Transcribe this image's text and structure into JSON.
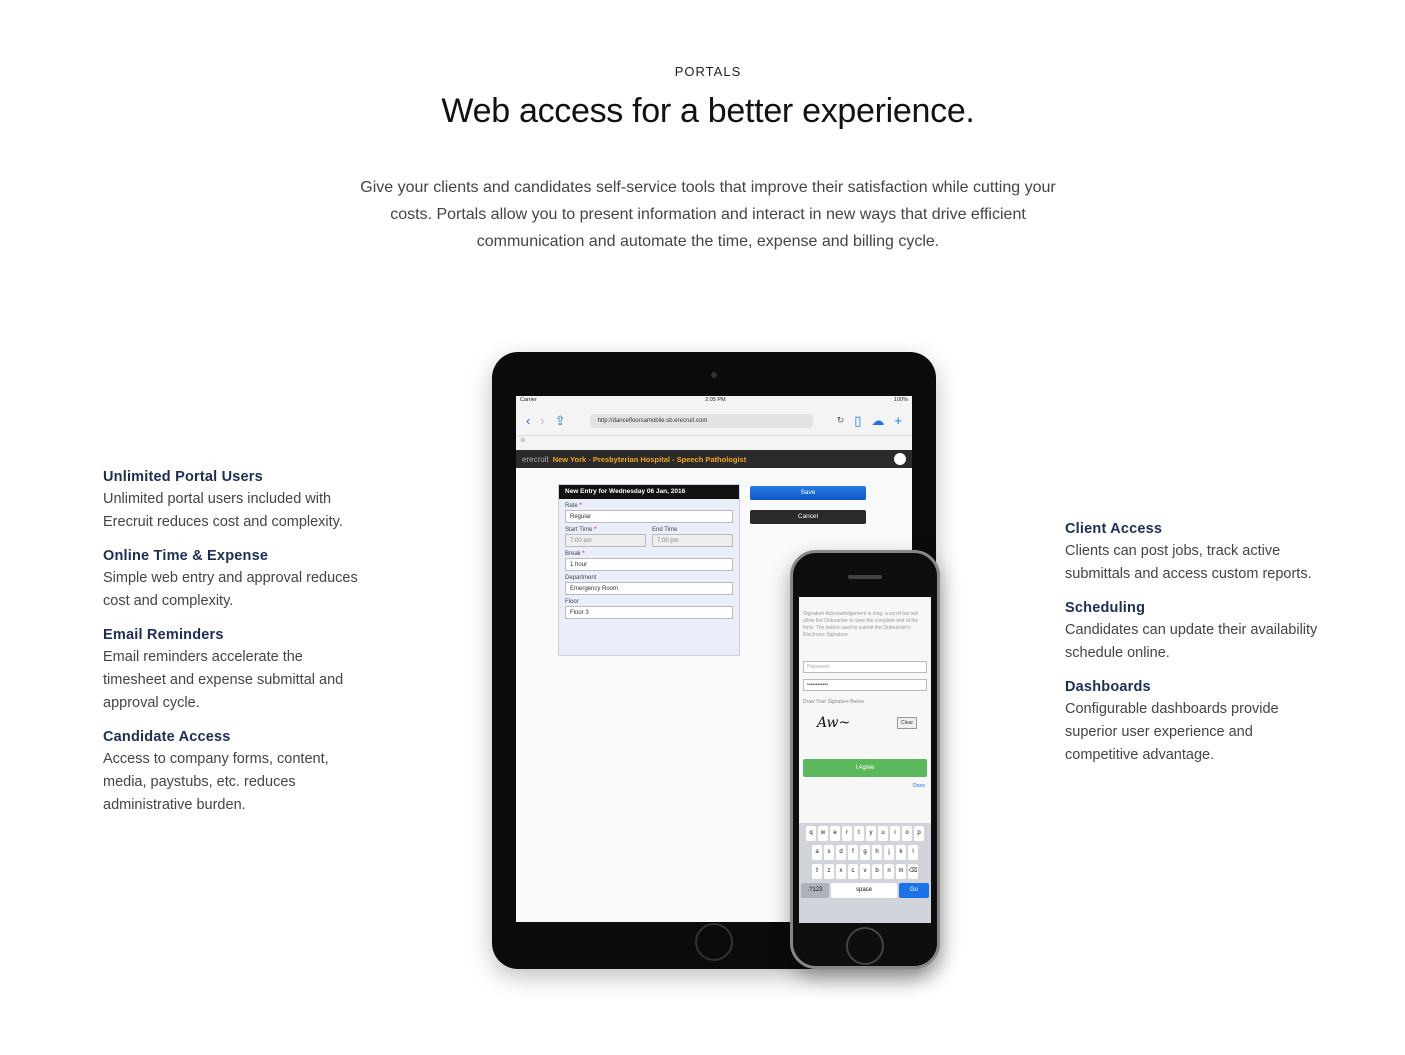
{
  "section": {
    "eyebrow": "PORTALS",
    "headline": "Web access for a better experience.",
    "intro": "Give your clients and candidates self-service tools that improve their satisfaction while cutting your costs. Portals allow you to present information and interact in new ways that drive efficient communication and automate the time, expense and billing cycle."
  },
  "features_left": [
    {
      "title": "Unlimited Portal Users",
      "desc": "Unlimited portal users included with Erecruit reduces cost and complexity."
    },
    {
      "title": "Online Time & Expense",
      "desc": "Simple web entry and approval reduces cost and complexity."
    },
    {
      "title": "Email Reminders",
      "desc": "Email reminders accelerate the timesheet and expense submittal and approval cycle."
    },
    {
      "title": "Candidate Access",
      "desc": "Access to company forms, content, media, paystubs, etc. reduces administrative burden."
    }
  ],
  "features_right": [
    {
      "title": "Client Access",
      "desc": "Clients can post jobs, track active submittals and access custom reports."
    },
    {
      "title": "Scheduling",
      "desc": "Candidates can update their availability schedule online."
    },
    {
      "title": "Dashboards",
      "desc": "Configurable dashboards provide superior user experience and competitive advantage."
    }
  ],
  "tablet": {
    "status_left": "Carrier",
    "status_time": "2:05 PM",
    "status_right": "100%",
    "url": "http://dancefloorsamobile.sb.erecruit.com",
    "app_brand": "erecruit",
    "app_title": "New York - Presbyterian Hospital - Speech Pathologist",
    "form_header": "New Entry for Wednesday 06 Jan, 2016",
    "rate_label": "Rate",
    "rate_value": "Regular",
    "start_label": "Start Time",
    "start_value": "7:00 am",
    "end_label": "End Time",
    "end_value": "7:00 pm",
    "break_label": "Break",
    "break_value": "1 hour",
    "department_label": "Department",
    "department_value": "Emergency Room",
    "floor_label": "Floor",
    "floor_value": "Floor 3",
    "save_label": "Save",
    "cancel_label": "Cancel",
    "required_mark": "*"
  },
  "phone": {
    "body_text": "Signature Acknowledgement is long, a scroll bar will allow the Onboarder to view the complete text of the form. The button used to submit the Onboarder's Electronic Signature",
    "password_placeholder": "Password",
    "password_value": "••••••••••••",
    "signature_label": "Draw Your Signature Below",
    "clear_label": "Clear",
    "agree_label": "I Agree",
    "done_label": "Done",
    "keys_row1": [
      "q",
      "w",
      "e",
      "r",
      "t",
      "y",
      "u",
      "i",
      "o",
      "p"
    ],
    "keys_row2": [
      "a",
      "s",
      "d",
      "f",
      "g",
      "h",
      "j",
      "k",
      "l"
    ],
    "keys_row3": [
      "⇧",
      "z",
      "x",
      "c",
      "v",
      "b",
      "n",
      "m",
      "⌫"
    ],
    "key_num": ".?123",
    "key_space": "space",
    "key_go": "Go"
  },
  "colors": {
    "heading_navy": "#1e2d57",
    "body_gray": "#444444",
    "app_orange": "#f5a623",
    "save_blue": "#0b56c3",
    "agree_green": "#5cb85c"
  }
}
